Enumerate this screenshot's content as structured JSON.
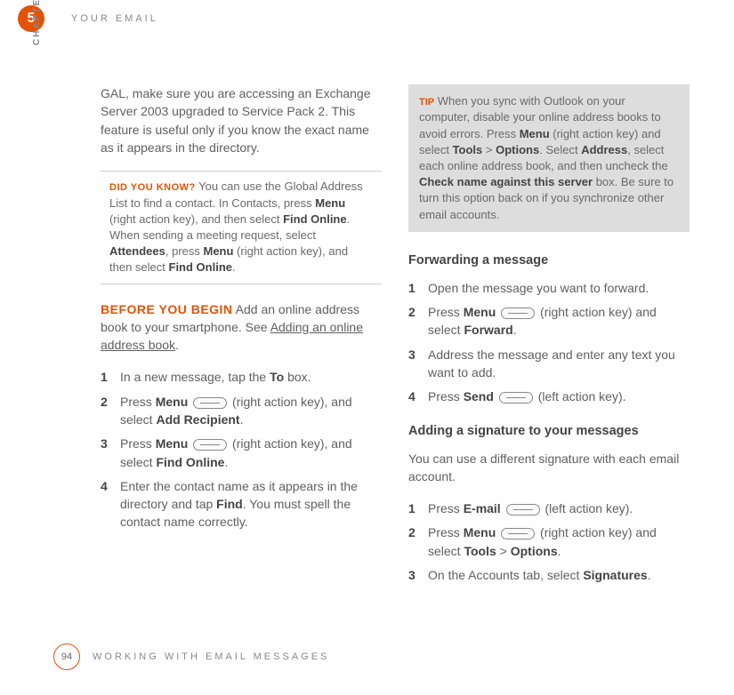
{
  "chapter": {
    "number": "5",
    "label": "CHAPTER",
    "title": "YOUR EMAIL"
  },
  "left": {
    "intro": "GAL, make sure you are accessing an Exchange Server 2003 upgraded to Service Pack 2. This feature is useful only if you know the exact name as it appears in the directory.",
    "callout": {
      "label": "DID YOU KNOW?",
      "t1": " You can use the Global Address List to find a contact. In Contacts, press ",
      "b1": "Menu",
      "t2": " (right action key), and then select ",
      "b2": "Find Online",
      "t3": ". When sending a meeting request, select ",
      "b3": "Attendees",
      "t4": ", press ",
      "b4": "Menu",
      "t5": " (right action key), and then select ",
      "b5": "Find Online",
      "t6": "."
    },
    "before": {
      "label": "BEFORE YOU BEGIN",
      "t1": "  Add an online address book to your smartphone. See ",
      "link": "Adding an online address book",
      "t2": "."
    },
    "steps": {
      "s1": {
        "num": "1",
        "t1": "In a new message, tap the ",
        "b1": "To",
        "t2": " box."
      },
      "s2": {
        "num": "2",
        "t1": "Press ",
        "b1": "Menu",
        "t2": " (right action key), and select ",
        "b2": "Add Recipient",
        "t3": "."
      },
      "s3": {
        "num": "3",
        "t1": "Press ",
        "b1": "Menu",
        "t2": " (right action key), and select ",
        "b2": "Find Online",
        "t3": "."
      },
      "s4": {
        "num": "4",
        "t1": "Enter the contact name as it appears in the directory and tap ",
        "b1": "Find",
        "t2": ". You must spell the contact name correctly."
      }
    }
  },
  "right": {
    "tip": {
      "label": "TIP",
      "t1": " When you sync with Outlook on your computer, disable your online address books to avoid errors. Press ",
      "b1": "Menu",
      "t2": " (right action key) and select ",
      "b2": "Tools",
      "t3": " > ",
      "b3": "Options",
      "t4": ". Select ",
      "b4": "Address",
      "t5": ", select each online address book, and then uncheck the ",
      "b5": "Check name against this server",
      "t6": " box. Be sure to turn this option back on if you synchronize other email accounts."
    },
    "fwd": {
      "heading": "Forwarding a message",
      "s1": {
        "num": "1",
        "txt": "Open the message you want to forward."
      },
      "s2": {
        "num": "2",
        "t1": "Press ",
        "b1": "Menu",
        "t2": " (right action key) and select ",
        "b2": "Forward",
        "t3": "."
      },
      "s3": {
        "num": "3",
        "txt": "Address the message and enter any text you want to add."
      },
      "s4": {
        "num": "4",
        "t1": "Press ",
        "b1": "Send",
        "t2": " (left action key)."
      }
    },
    "sig": {
      "heading": "Adding a signature to your messages",
      "intro": "You can use a different signature with each email account.",
      "s1": {
        "num": "1",
        "t1": "Press ",
        "b1": "E-mail",
        "t2": " (left action key)."
      },
      "s2": {
        "num": "2",
        "t1": "Press ",
        "b1": "Menu",
        "t2": " (right action key) and select ",
        "b2": "Tools",
        "t3": " > ",
        "b3": "Options",
        "t4": "."
      },
      "s3": {
        "num": "3",
        "t1": "On the Accounts tab, select ",
        "b1": "Signatures",
        "t2": "."
      }
    }
  },
  "footer": {
    "page": "94",
    "title": "WORKING WITH EMAIL MESSAGES"
  }
}
